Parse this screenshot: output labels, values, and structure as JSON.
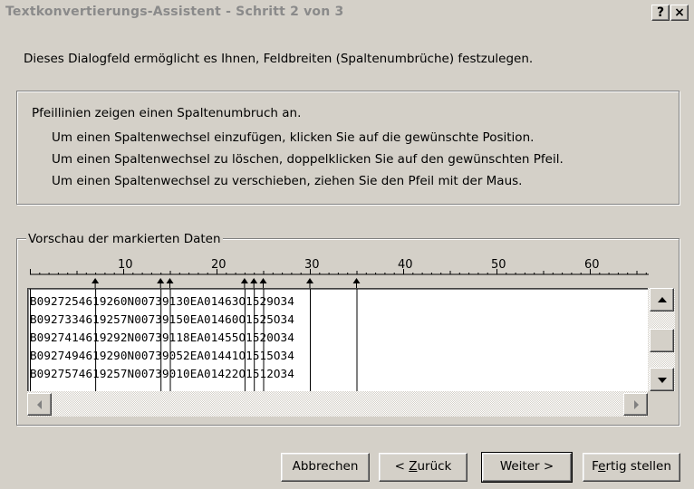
{
  "window": {
    "title": "Textkonvertierungs-Assistent - Schritt 2 von 3",
    "help_label": "?",
    "close_label": "×"
  },
  "intro": "Dieses Dialogfeld ermöglicht es Ihnen, Feldbreiten (Spaltenumbrüche) festzulegen.",
  "info": {
    "heading": "Pfeillinien zeigen einen Spaltenumbruch an.",
    "lines": [
      "Um einen Spaltenwechsel einzufügen, klicken Sie auf die gewünschte Position.",
      "Um einen Spaltenwechsel zu löschen, doppelklicken Sie auf den gewünschten Pfeil.",
      "Um einen Spaltenwechsel zu verschieben, ziehen Sie den Pfeil mit der Maus."
    ]
  },
  "preview": {
    "label": "Vorschau der markierten Daten",
    "ruler_labels": [
      "10",
      "20",
      "30",
      "40",
      "50",
      "60"
    ],
    "break_positions": [
      7,
      14,
      15,
      23,
      24,
      25,
      30,
      35
    ],
    "rows": [
      "B0927254619260N00739130EA01463O1529O34",
      "B0927334619257N00739150EA01460O1525O34",
      "B0927414619292N00739118EA01455O1520O34",
      "B0927494619290N00739052EA01441O1515O34",
      "B0927574619257N00739010EA01422O1512O34"
    ]
  },
  "buttons": {
    "cancel": "Abbrechen",
    "back_prefix": "< ",
    "back_ul": "Z",
    "back_rest": "urück",
    "next": "Weiter >",
    "finish_prefix": "F",
    "finish_ul": "e",
    "finish_rest": "rtig stellen"
  }
}
